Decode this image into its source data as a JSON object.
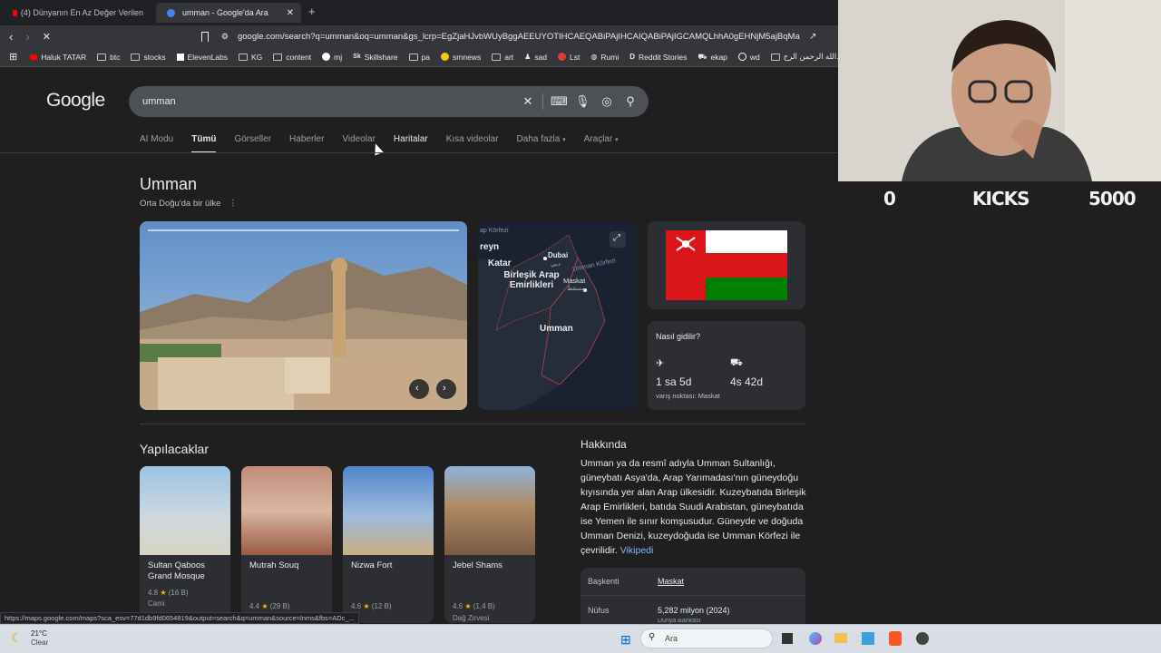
{
  "browser": {
    "tabs": [
      {
        "title": "(4) Dünyanın En Az Değer Verilen"
      },
      {
        "title": "umman - Google'da Ara"
      }
    ],
    "new_tab": "+",
    "url": "google.com/search?q=umman&oq=umman&gs_lcrp=EgZjaHJvbWUyBggAEEUYOTIHCAEQABiPAjIHCAIQABiPAjIGCAMQLhhA0gEHNjM5ajBqMagCAL...",
    "bookmarks": [
      "Haluk TATAR",
      "btc",
      "stocks",
      "ElevenLabs",
      "KG",
      "content",
      "mj",
      "Skillshare",
      "pa",
      "smnews",
      "art",
      "sad",
      "Lst",
      "Rumi",
      "Reddit Stories",
      "ekap",
      "wd",
      "الله الرحمن الرح..."
    ],
    "status_url": "https://maps.google.com/maps?sca_esv=77d1db9fd0654819&output=search&q=umman&source=lnms&fbs=ADc_..."
  },
  "google": {
    "logo": "Google",
    "query": "umman",
    "tabs": [
      "AI Modu",
      "Tümü",
      "Görseller",
      "Haberler",
      "Videolar",
      "Haritalar",
      "Kısa videolar",
      "Daha fazla",
      "Araçlar"
    ],
    "active_tab": "Tümü"
  },
  "entity": {
    "title": "Umman",
    "subtitle": "Orta Doğu'da bir ülke",
    "map_labels": {
      "gulf1": "ap Körfezi",
      "bahrain": "reyn",
      "qatar": "Katar",
      "dubai": "Dubai",
      "dubai_ar": "دبي",
      "uae": "Birleşik Arap Emirlikleri",
      "muscat": "Maskat",
      "muscat_ar": "مسقط",
      "gulf2": "Umman Körfezi",
      "oman": "Umman"
    },
    "how_to_get": {
      "title": "Nasıl gidilir?",
      "flight": "1 sa 5d",
      "car": "4s 42d",
      "destination": "varış noktası: Maskat"
    }
  },
  "things_to_do": {
    "heading": "Yapılacaklar",
    "places": [
      {
        "name": "Sultan Qaboos Grand Mosque",
        "rating": "4.8",
        "reviews": "(16 B)",
        "type": "Cami"
      },
      {
        "name": "Mutrah Souq",
        "rating": "4.4",
        "reviews": "(29 B)",
        "type": ""
      },
      {
        "name": "Nizwa Fort",
        "rating": "4.6",
        "reviews": "(12 B)",
        "type": ""
      },
      {
        "name": "Jebel Shams",
        "rating": "4.6",
        "reviews": "(1,4 B)",
        "type": "Dağ Zirvesi"
      }
    ]
  },
  "about": {
    "heading": "Hakkında",
    "text": "Umman ya da resmî adıyla Umman Sultanlığı, güneybatı Asya'da, Arap Yarımadası'nın güneydoğu kıyısında yer alan Arap ülkesidir. Kuzeybatıda Birleşik Arap Emirlikleri, batıda Suudi Arabistan, güneybatıda ise Yemen ile sınır komşusudur. Güneyde ve doğuda Umman Denizi, kuzeydoğuda ise Umman Körfezi ile çevrilidir.",
    "source": "Vikipedi",
    "facts": [
      {
        "label": "Başkenti",
        "value": "Maskat"
      },
      {
        "label": "Nüfus",
        "value": "5,282 milyon (2024)"
      }
    ],
    "facts_partial": "Dünya Bankası"
  },
  "overlay": {
    "left": "0",
    "label": "KICKS",
    "right": "5000"
  },
  "taskbar": {
    "temperature": "21°C",
    "weather": "Clear",
    "search": "Ara"
  },
  "colors": {
    "page_bg": "#1f1f1f",
    "card_bg": "#2c2e33",
    "link": "#8ab4f8",
    "flag_red": "#db161b",
    "flag_green": "#008000"
  }
}
